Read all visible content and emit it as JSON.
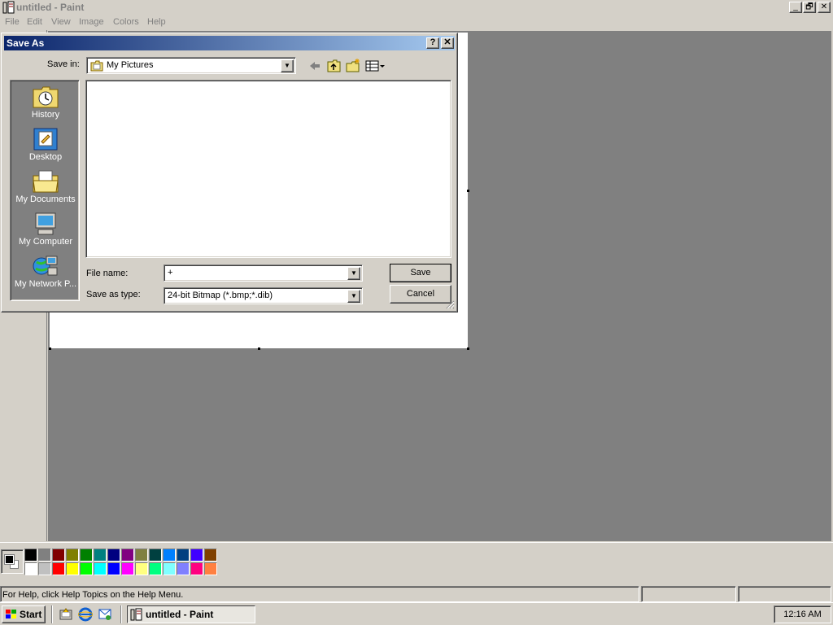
{
  "window": {
    "title": "untitled - Paint",
    "menus": [
      "File",
      "Edit",
      "View",
      "Image",
      "Colors",
      "Help"
    ],
    "caption_buttons": [
      "_",
      "🗗",
      "✕"
    ]
  },
  "palette": {
    "top_row": [
      "#000000",
      "#808080",
      "#800000",
      "#808000",
      "#008000",
      "#008080",
      "#000080",
      "#800080",
      "#808040",
      "#004040",
      "#0080ff",
      "#004080",
      "#4000ff",
      "#804000"
    ],
    "bottom_row": [
      "#ffffff",
      "#c0c0c0",
      "#ff0000",
      "#ffff00",
      "#00ff00",
      "#00ffff",
      "#0000ff",
      "#ff00ff",
      "#ffff80",
      "#00ff80",
      "#80ffff",
      "#8080ff",
      "#ff0080",
      "#ff8040"
    ],
    "foreground": "#000000",
    "background": "#ffffff"
  },
  "status": {
    "help_text": "For Help, click Help Topics on the Help Menu."
  },
  "taskbar": {
    "start_label": "Start",
    "task_label": "untitled - Paint",
    "clock": "12:16 AM"
  },
  "dialog": {
    "title": "Save As",
    "help_btn": "?",
    "close_btn": "✕",
    "save_in_label": "Save in:",
    "save_in_value": "My Pictures",
    "places": [
      "History",
      "Desktop",
      "My Documents",
      "My Computer",
      "My Network P..."
    ],
    "file_name_label": "File name:",
    "file_name_value": "+",
    "save_type_label": "Save as type:",
    "save_type_value": "24-bit Bitmap (*.bmp;*.dib)",
    "save_button": "Save",
    "cancel_button": "Cancel"
  }
}
